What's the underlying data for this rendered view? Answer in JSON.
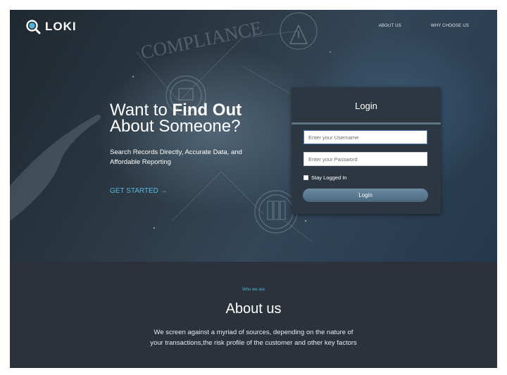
{
  "brand": {
    "name": "LOKI",
    "icon": "magnifier-logo-icon"
  },
  "nav": {
    "items": [
      {
        "label": "ABOUT US"
      },
      {
        "label": "WHY CHOOSE US"
      }
    ]
  },
  "hero": {
    "headline_prefix": "Want to ",
    "headline_bold": "Find Out",
    "headline_line2": "About Someone?",
    "subtext": "Search Records Directly, Accurate Data, and Affordable Reporting",
    "cta": "GET STARTED →",
    "background_words": [
      "COMPLIANCE"
    ]
  },
  "login": {
    "title": "Login",
    "username_placeholder": "Enter your Username",
    "password_placeholder": "Enter your Password",
    "remember_label": "Stay Logged In",
    "submit_label": "Login"
  },
  "about": {
    "eyebrow": "Who we are",
    "title": "About us",
    "body": "We screen against a myriad of sources, depending on the nature of your transactions,the risk profile of the customer and other key factors"
  },
  "colors": {
    "accent": "#4fb3d9",
    "hero_dark": "#1e2830",
    "card": "#2d3742",
    "section": "#2b323c",
    "button": "#5c7a91"
  }
}
